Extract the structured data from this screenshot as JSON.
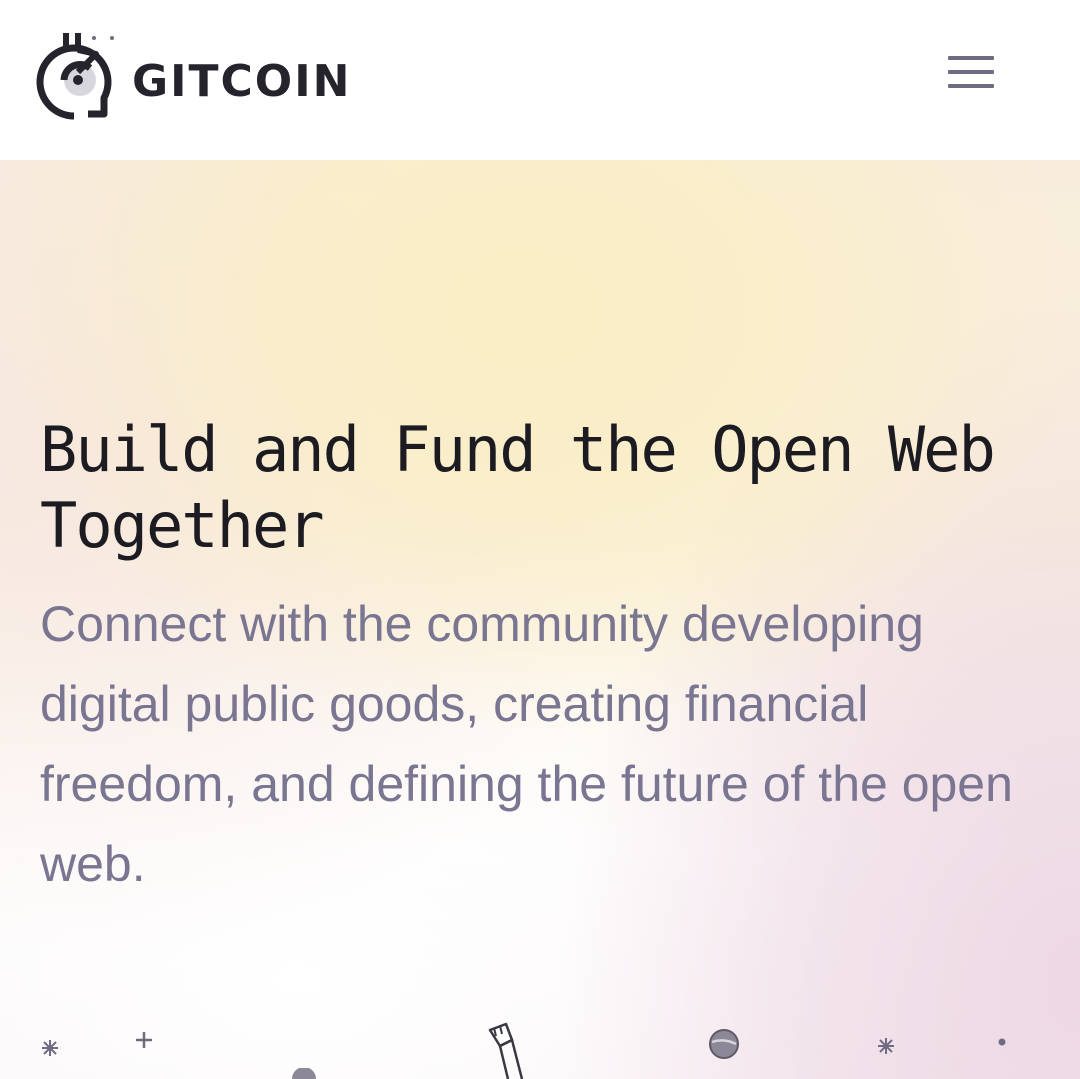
{
  "header": {
    "logo_text": "GITCOIN",
    "logo_icon": "gitcoin-logo-icon",
    "menu_icon": "hamburger-menu-icon"
  },
  "hero": {
    "title": "Build and Fund the Open Web Together",
    "subtitle": "Connect with the community developing digital public goods, creating financial freedom, and defining the future of the open web."
  },
  "colors": {
    "text_dark": "#1d1b22",
    "text_muted": "#7a7590",
    "menu_icon": "#6f6b82",
    "hero_yellow": "#faeec4",
    "hero_pink": "#ecd6e2"
  },
  "illustration_icons": [
    "sparkle-icon",
    "plus-star-icon",
    "astronaut-arm-icon",
    "planet-icon",
    "sparkle-icon",
    "dot-star-icon"
  ]
}
